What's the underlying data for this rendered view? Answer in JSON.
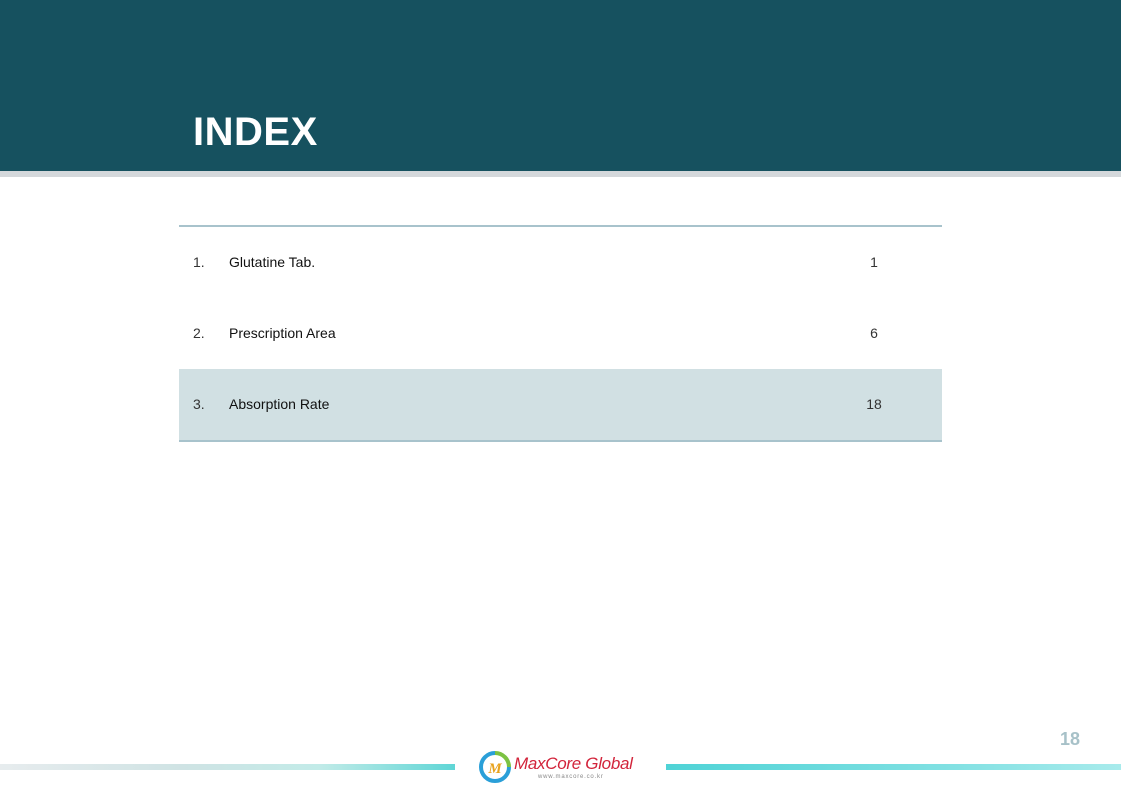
{
  "header": {
    "title": "INDEX"
  },
  "index": {
    "rows": [
      {
        "number": "1.",
        "label": "Glutatine Tab.",
        "page": "1",
        "active": false
      },
      {
        "number": "2.",
        "label": "Prescription Area",
        "page": "6",
        "active": false
      },
      {
        "number": "3.",
        "label": "Absorption Rate",
        "page": "18",
        "active": true
      }
    ]
  },
  "footer": {
    "page_number": "18",
    "logo_name": "MaxCore Global",
    "logo_url": "www.maxcore.co.kr",
    "logo_icon": "maxcore-logo-icon"
  },
  "colors": {
    "header_band": "#16515f",
    "active_row": "#d1e0e3",
    "rule": "#a8c3cc",
    "brand_red": "#d2243b"
  }
}
